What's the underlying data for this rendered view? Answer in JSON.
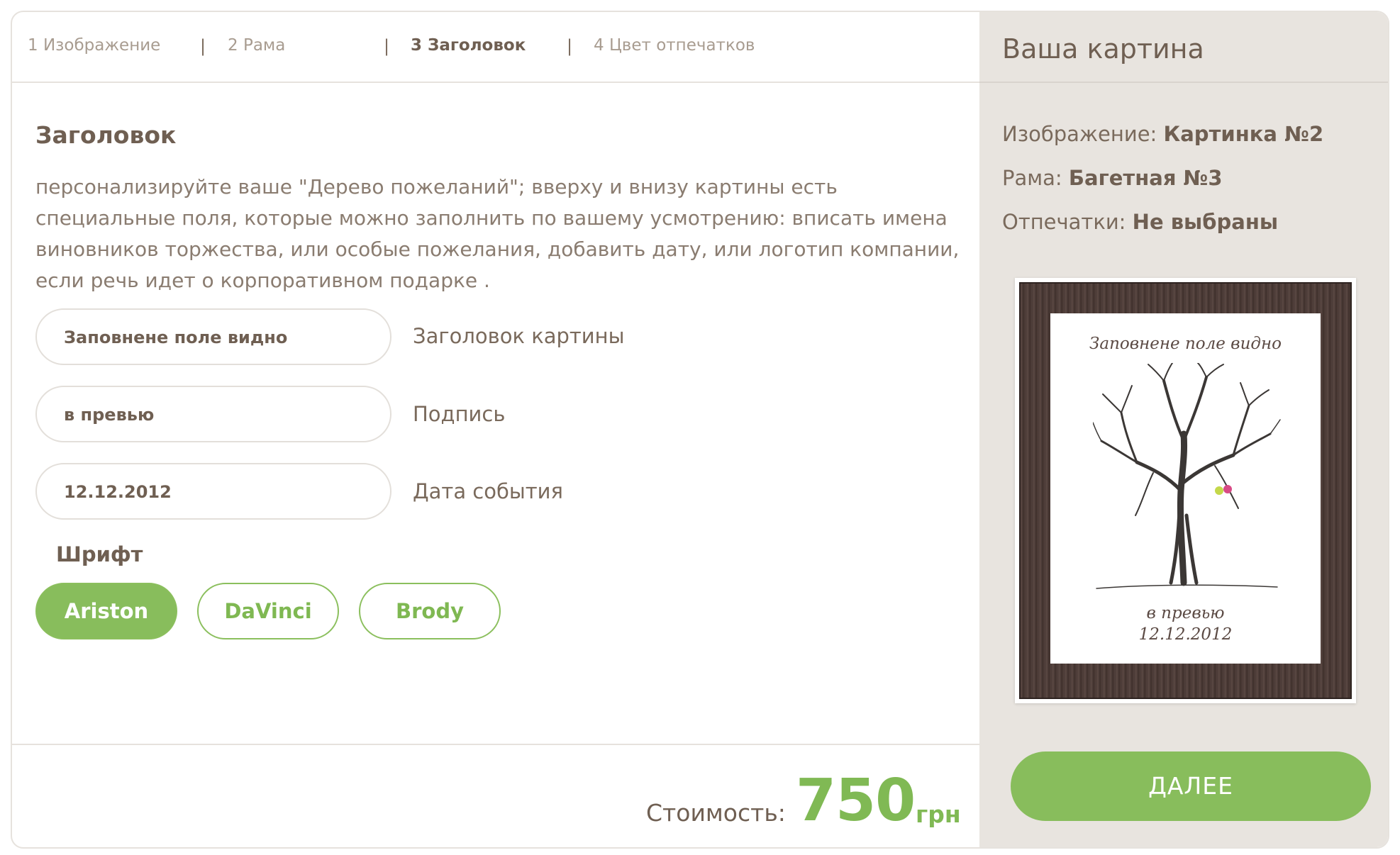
{
  "steps": [
    {
      "label": "1 Изображение",
      "active": false
    },
    {
      "label": "2 Рама",
      "active": false
    },
    {
      "label": "3 Заголовок",
      "active": true
    },
    {
      "label": "4 Цвет отпечатков",
      "active": false
    }
  ],
  "step_separator": "|",
  "section": {
    "title": "Заголовок",
    "description": "персонализируйте ваше \"Дерево пожеланий\"; вверху и внизу картины есть специальные поля, которые можно заполнить по вашему усмотрению: вписать имена виновников торжества, или особые пожелания, добавить дату, или логотип компании, если речь идет о корпоративном подарке ."
  },
  "fields": [
    {
      "value": "Заповнене поле видно",
      "label": "Заголовок картины"
    },
    {
      "value": "в превью",
      "label": "Подпись"
    },
    {
      "value": "12.12.2012",
      "label": "Дата события"
    }
  ],
  "font": {
    "label": "Шрифт",
    "options": [
      {
        "label": "Ariston",
        "selected": true
      },
      {
        "label": "DaVinci",
        "selected": false
      },
      {
        "label": "Brody",
        "selected": false
      }
    ]
  },
  "price": {
    "label": "Стоимость:",
    "value": "750",
    "currency": "грн"
  },
  "summary": {
    "title": "Ваша картина",
    "image_label": "Изображение:",
    "image_value": "Картинка №2",
    "frame_label": "Рама:",
    "frame_value": "Багетная №3",
    "prints_label": "Отпечатки:",
    "prints_value": "Не выбраны"
  },
  "preview": {
    "title": "Заповнене поле видно",
    "signature": "в превью",
    "date": "12.12.2012"
  },
  "next_button": "ДАЛЕЕ",
  "colors": {
    "accent": "#88bd5c",
    "text": "#6f5f52",
    "panel": "#e8e4df"
  }
}
